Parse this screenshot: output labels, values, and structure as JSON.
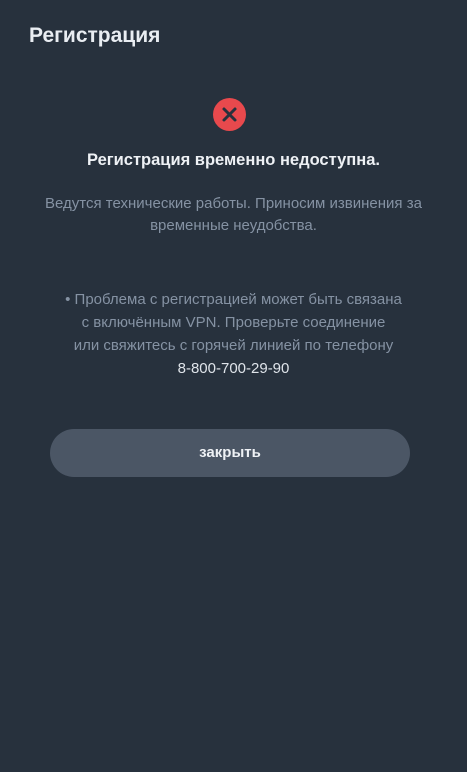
{
  "modal": {
    "title": "Регистрация",
    "icon": "error-circle-x-icon",
    "colors": {
      "background": "#27313d",
      "error": "#e8494d",
      "button": "#4b5665"
    },
    "heading": "Регистрация временно недоступна.",
    "description": "Ведутся технические работы. Приносим извинения за временные неудобства.",
    "note": {
      "line1": "• Проблема с регистрацией может быть связана",
      "line2": "с включённым VPN. Проверьте соединение",
      "line3": "или свяжитесь с горячей линией по телефону",
      "phone": "8-800-700-29-90"
    },
    "close_label": "закрыть"
  }
}
